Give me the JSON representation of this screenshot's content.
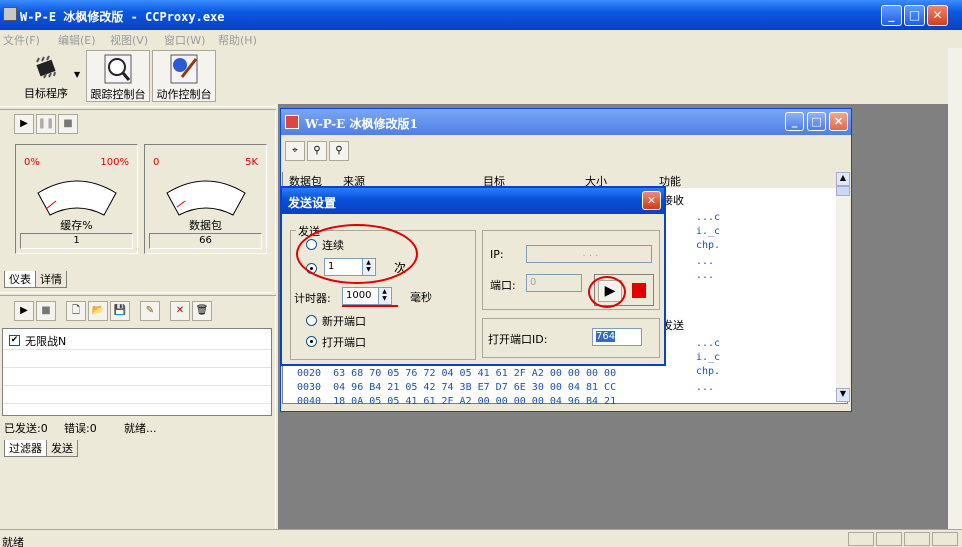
{
  "window": {
    "title": "W-P-E 冰枫修改版 - CCProxy.exe",
    "min": "_",
    "max": "□",
    "close": "✕"
  },
  "menu": [
    "文件(F)",
    "编辑(E)",
    "视图(V)",
    "窗口(W)",
    "帮助(H)"
  ],
  "toolbar": {
    "target": "目标程序",
    "trace": "跟踪控制台",
    "action": "动作控制台"
  },
  "gauges": [
    {
      "lo": "0%",
      "hi": "100%",
      "name": "缓存%",
      "value": "1"
    },
    {
      "lo": "0",
      "hi": "5K",
      "name": "数据包",
      "value": "66"
    }
  ],
  "tabs_top": [
    "仪表",
    "详情"
  ],
  "filter_list": [
    {
      "label": "无限战N",
      "checked": true
    }
  ],
  "status_left": {
    "sent": "已发送:0",
    "errors": "错误:0",
    "state": "就绪..."
  },
  "tabs_bottom": [
    "过滤器",
    "发送"
  ],
  "status_bar": "就绪",
  "child": {
    "title": "W-P-E 冰枫修改版1"
  },
  "grid": {
    "columns": [
      "数据包",
      "来源",
      "目标",
      "大小",
      "功能"
    ],
    "right_labels": [
      "接收",
      "发送"
    ],
    "right_fragments_a": [
      "...c",
      "i._c",
      "chp.",
      "...",
      "..."
    ],
    "right_fragments_b": [
      "...c",
      "i._c",
      "chp.",
      "..."
    ],
    "hex_rows": [
      "0020  63 68 70 05 76 72 04 05 41 61 2F A2 00 00 00 00",
      "0030  04 96 B4 21 05 42 74 3B E7 D7 6E 30 00 04 81 CC",
      "0040  18 0A 05 05 41 61 2F A2 00 00 00 00 04 96 B4 21"
    ]
  },
  "dialog": {
    "title": "发送设置",
    "group_label": "发送",
    "continuous": "连续",
    "count_value": "1",
    "count_unit": "次",
    "timer_label": "计时器:",
    "timer_value": "1000",
    "timer_unit": "毫秒",
    "new_port": "新开端口",
    "open_port": "打开端口",
    "ip_label": "IP:",
    "ip_value": ".  .  .",
    "port_label": "端口:",
    "port_value": "0",
    "open_port_id_label": "打开端口ID:",
    "open_port_id_value": "764",
    "close": "✕"
  }
}
